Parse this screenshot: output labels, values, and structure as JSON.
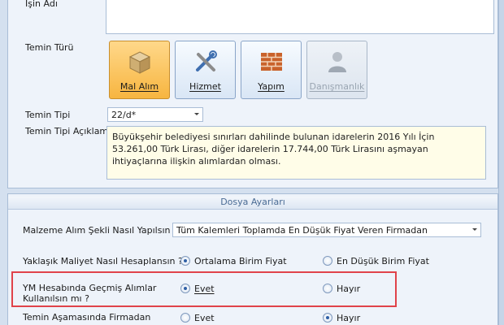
{
  "form": {
    "isin_adi_label": "İşin Adı",
    "temin_turu_label": "Temin Türü",
    "temin_tipi_label": "Temin Tipi",
    "temin_tipi_value": "22/d*",
    "temin_tipi_aciklama_label": "Temin Tipi Açıklama",
    "temin_tipi_aciklama_text": "Büyükşehir belediyesi sınırları dahilinde bulunan idarelerin 2016 Yılı İçin 53.261,00 Türk Lirası, diğer idarelerin 17.744,00 Türk Lirasını aşmayan ihtiyaçlarına ilişkin alımlardan olması."
  },
  "tiles": [
    {
      "label": "Mal Alım",
      "icon": "box-icon",
      "active": true,
      "disabled": false
    },
    {
      "label": "Hizmet",
      "icon": "tools-icon",
      "active": false,
      "disabled": false
    },
    {
      "label": "Yapım",
      "icon": "brick-wall-icon",
      "active": false,
      "disabled": false
    },
    {
      "label": "Danışmanlık",
      "icon": "consultant-icon",
      "active": false,
      "disabled": true
    }
  ],
  "dosya": {
    "section_title": "Dosya Ayarları",
    "malzeme_label": "Malzeme Alım Şekli Nasıl Yapılsın ?",
    "malzeme_value": "Tüm Kalemleri Toplamda En Düşük Fiyat Veren Firmadan",
    "maliyet_label": "Yaklaşık Maliyet Nasıl Hesaplansın ?",
    "maliyet_opt1": "Ortalama Birim Fiyat",
    "maliyet_opt2": "En Düşük Birim Fiyat",
    "ym_label_line1": "YM Hesabında Geçmiş Alımlar",
    "ym_label_line2": "Kullanılsın mı ?",
    "ym_opt1": "Evet",
    "ym_opt2": "Hayır",
    "temin_asama_label": "Temin Aşamasında Firmadan",
    "temin_asama_opt1": "Evet",
    "temin_asama_opt2": "Hayır"
  },
  "colors": {
    "active_tile": "#f7b540",
    "highlight": "#e0434a",
    "section_text": "#4a6b94"
  }
}
